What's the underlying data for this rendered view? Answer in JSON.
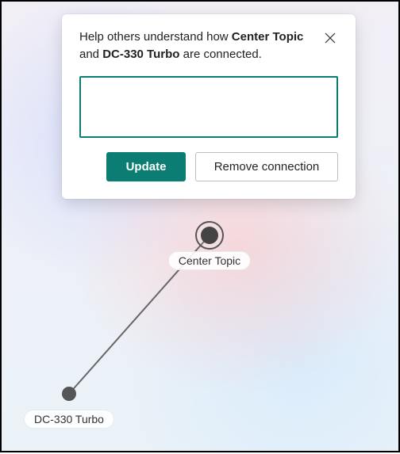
{
  "dialog": {
    "prompt_prefix": "Help others understand how ",
    "prompt_mid": " and ",
    "prompt_suffix": " are connected.",
    "topic_a": "Center Topic",
    "topic_b": "DC-330 Turbo",
    "description_value": "",
    "description_placeholder": "",
    "update_label": "Update",
    "remove_label": "Remove connection"
  },
  "graph": {
    "center_node_label": "Center Topic",
    "related_node_label": "DC-330 Turbo"
  },
  "colors": {
    "accent": "#0b7d72"
  }
}
